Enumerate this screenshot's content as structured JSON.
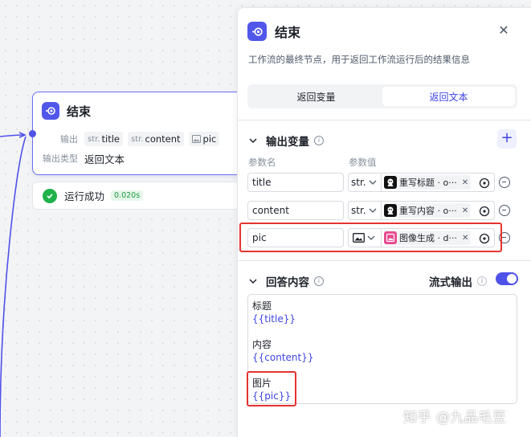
{
  "node": {
    "title": "结束",
    "output_label": "输出",
    "output_vars": [
      {
        "type": "str.",
        "name": "title"
      },
      {
        "type": "str.",
        "name": "content"
      },
      {
        "type": "image",
        "name": "pic"
      }
    ],
    "output_type_label": "输出类型",
    "output_type_value": "返回文本",
    "status_text": "运行成功",
    "status_time": "0.020s"
  },
  "panel": {
    "title": "结束",
    "description": "工作流的最终节点，用于返回工作流运行后的结果信息",
    "tabs": [
      {
        "label": "返回变量",
        "active": false
      },
      {
        "label": "返回文本",
        "active": true
      }
    ],
    "output_section": {
      "title": "输出变量",
      "col_name": "参数名",
      "col_value": "参数值",
      "rows": [
        {
          "name": "title",
          "type": "str.",
          "ref_icon": "bot-icon",
          "ref": "重写标题 · o···"
        },
        {
          "name": "content",
          "type": "str.",
          "ref_icon": "bot-icon",
          "ref": "重写内容 · o···"
        },
        {
          "name": "pic",
          "type": "image",
          "ref_icon": "image-gen-icon",
          "ref": "图像生成 · d···"
        }
      ]
    },
    "answer_section": {
      "title": "回答内容",
      "stream_label": "流式输出",
      "stream_enabled": true,
      "lines": [
        {
          "text": "标题",
          "is_var": false
        },
        {
          "text": "{{title}}",
          "is_var": true
        },
        {
          "text": "",
          "is_var": false
        },
        {
          "text": "内容",
          "is_var": false
        },
        {
          "text": "{{content}}",
          "is_var": true
        },
        {
          "text": "",
          "is_var": false
        },
        {
          "text": "图片",
          "is_var": false
        },
        {
          "text": "{{pic}}",
          "is_var": true
        }
      ]
    }
  },
  "watermark": "知乎 @九品毛豆",
  "colors": {
    "accent": "#5157ea",
    "highlight": "#e53330",
    "success": "#1fb24a"
  }
}
